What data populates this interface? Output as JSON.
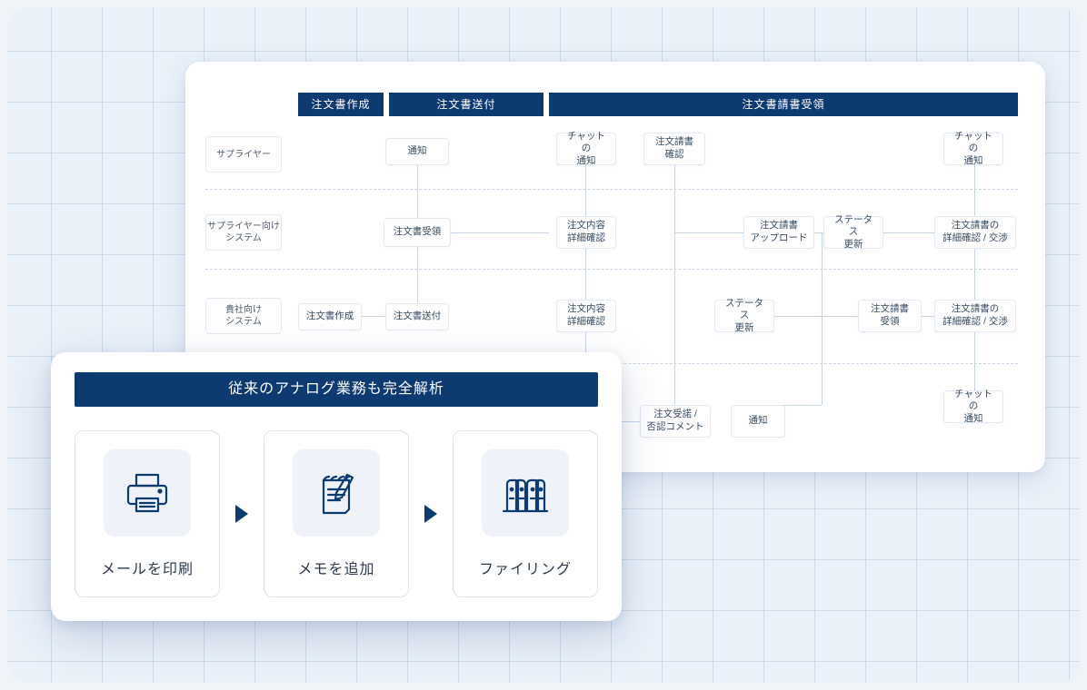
{
  "flow": {
    "headers": {
      "h1": "注文書作成",
      "h2": "注文書送付",
      "h3": "注文書請書受領"
    },
    "lanes": {
      "l1": "サプライヤー",
      "l2": "サプライヤー向け\nシステム",
      "l3": "貴社向け\nシステム"
    },
    "nodes": {
      "n_tsuchi": "通知",
      "n_chat1": "チャットの\n通知",
      "n_kakunin": "注文請書\n確認",
      "n_chat2": "チャットの\n通知",
      "n_juryo": "注文書受領",
      "n_naiyo1": "注文内容\n詳細確認",
      "n_upload": "注文請書\nアップロード",
      "n_status1": "ステータス\n更新",
      "n_shosai1": "注文請書の\n詳細確認 / 交渉",
      "n_sakusei": "注文書作成",
      "n_sofu": "注文書送付",
      "n_naiyo2": "注文内容\n詳細確認",
      "n_status2": "ステータス\n更新",
      "n_juryo2": "注文請書\n受領",
      "n_shosai2": "注文請書の\n詳細確認 / 交渉",
      "n_jucho": "注文受諾 /\n否認コメント",
      "n_tsuchi2": "通知",
      "n_chat3": "チャットの\n通知"
    }
  },
  "overlay": {
    "title": "従来のアナログ業務も完全解析",
    "steps": {
      "s1": "メールを印刷",
      "s2": "メモを追加",
      "s3": "ファイリング"
    }
  }
}
